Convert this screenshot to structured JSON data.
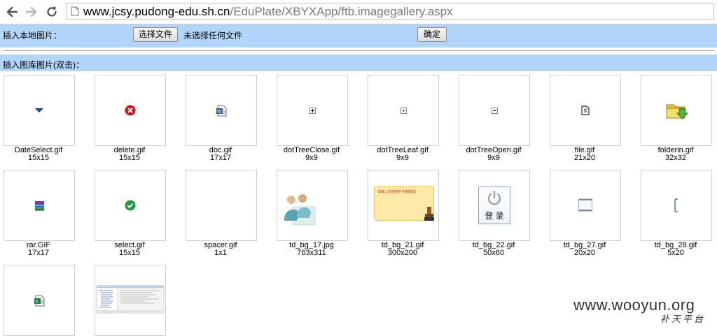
{
  "browser": {
    "url_host": "www.jcsy.pudong-edu.sh.cn",
    "url_path": "/EduPlate/XBYXApp/ftb.imagegallery.aspx"
  },
  "upload": {
    "label": "插入本地图片：",
    "choose_button": "选择文件",
    "file_status": "未选择任何文件",
    "confirm_button": "确定"
  },
  "gallery": {
    "label": "插入图库图片(双击)：",
    "items": [
      {
        "name": "DateSelect.gif",
        "size": "15x15",
        "icon": "dropdown-arrow-icon"
      },
      {
        "name": "delete.gif",
        "size": "15x15",
        "icon": "delete-icon"
      },
      {
        "name": "doc.gif",
        "size": "17x17",
        "icon": "word-doc-icon"
      },
      {
        "name": "dotTreeClose.gif",
        "size": "9x9",
        "icon": "tree-plus-icon"
      },
      {
        "name": "dotTreeLeaf.gif",
        "size": "9x9",
        "icon": "tree-leaf-icon"
      },
      {
        "name": "dotTreeOpen.gif",
        "size": "9x9",
        "icon": "tree-minus-icon"
      },
      {
        "name": "file.gif",
        "size": "21x20",
        "icon": "file-icon"
      },
      {
        "name": "folderin.gif",
        "size": "32x32",
        "icon": "folder-in-icon"
      },
      {
        "name": "rar.GIF",
        "size": "17x17",
        "icon": "rar-icon"
      },
      {
        "name": "select.gif",
        "size": "15x15",
        "icon": "check-icon"
      },
      {
        "name": "spacer.gif",
        "size": "1x1",
        "icon": "spacer-image"
      },
      {
        "name": "td_bg_17.jpg",
        "size": "763x311",
        "icon": "people-image"
      },
      {
        "name": "td_bg_21.gif",
        "size": "300x200",
        "icon": "notice-banner-image",
        "banner_text": "请输入您的用户名和密码"
      },
      {
        "name": "td_bg_22.gif",
        "size": "50x60",
        "icon": "power-login-icon",
        "login_text": "登 录"
      },
      {
        "name": "td_bg_27.gif",
        "size": "20x20",
        "icon": "box-image"
      },
      {
        "name": "td_bg_28.gif",
        "size": "5x20",
        "icon": "bracket-image"
      },
      {
        "name": "",
        "size": "",
        "icon": "excel-icon"
      },
      {
        "name": "",
        "size": "",
        "icon": "screenshot-image"
      }
    ]
  },
  "watermark": {
    "site": "www.wooyun.org",
    "sub": "补天平台"
  }
}
